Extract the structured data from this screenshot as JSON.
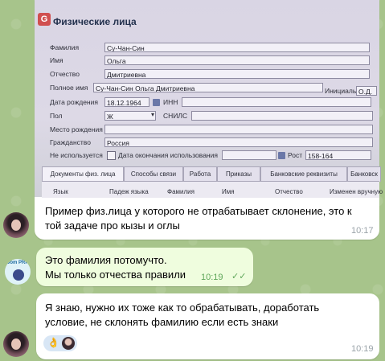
{
  "form": {
    "title": "Физические лица",
    "logo": "G",
    "labels": {
      "familia": "Фамилия",
      "imya": "Имя",
      "otchestvo": "Отчество",
      "polnoe": "Полное имя",
      "data_rozhd": "Дата рождения",
      "inn": "ИНН",
      "pol": "Пол",
      "snils": "СНИЛС",
      "mesto": "Место рождения",
      "grazhd": "Гражданство",
      "ne_isp": "Не используется",
      "data_okonch": "Дата окончания использования",
      "rost": "Рост",
      "inicialy": "Инициалы"
    },
    "values": {
      "familia": "Су-Чан-Син",
      "imya": "Ольга",
      "otchestvo": "Дмитриевна",
      "polnoe": "Су-Чан-Син Ольга Дмитриевна",
      "data_rozhd": "18.12.1964",
      "pol": "Ж",
      "grazhd": "Россия",
      "rost": "158-164",
      "inicialy": "О.Д."
    },
    "tabs": [
      "Документы физ. лица",
      "Способы связи",
      "Работа",
      "Приказы",
      "Банковские реквизиты",
      "Банковск"
    ],
    "columns": [
      "Язык",
      "Падеж языка",
      "Фамилия",
      "Имя",
      "Отчество",
      "Изменен вручную"
    ]
  },
  "messages": [
    {
      "id": "m1",
      "lines": [
        "Пример физ.лица у которого не отрабатывает склонение, это к",
        "той задаче про кызы и оглы"
      ],
      "time": "10:17"
    },
    {
      "id": "m2",
      "lines": [
        "Это фамилия потомучто.",
        "Мы только отчества правили"
      ],
      "time": "10:19"
    },
    {
      "id": "m3",
      "lines": [
        "Я знаю, нужно их тоже как то обрабатывать, доработать",
        "условие, не склонять фамилию если есть знаки"
      ],
      "time": "10:19"
    }
  ],
  "reaction": {
    "emoji": "👌"
  },
  "avatar_badge": {
    "text": "Dom PRP"
  },
  "colors": {
    "chat_bg": "#a7c48b",
    "out_bubble": "#effdde",
    "in_bubble": "#ffffff",
    "check": "#5ea659"
  }
}
